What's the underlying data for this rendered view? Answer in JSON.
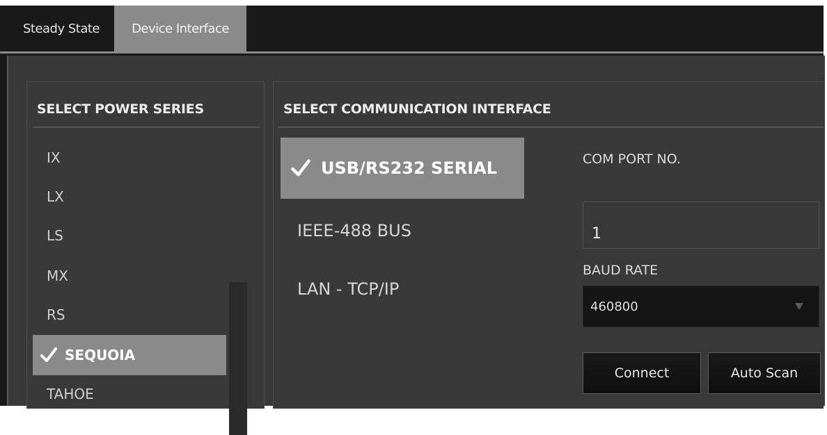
{
  "tabs": [
    {
      "label": "Steady State",
      "active": false
    },
    {
      "label": "Device Interface",
      "active": true
    }
  ],
  "power_series": {
    "title": "SELECT POWER SERIES",
    "items": [
      "IX",
      "LX",
      "LS",
      "MX",
      "RS",
      "SEQUOIA",
      "TAHOE"
    ],
    "selected": "SEQUOIA"
  },
  "communication": {
    "title": "SELECT COMMUNICATION INTERFACE",
    "interfaces": [
      "USB/RS232 SERIAL",
      "IEEE-488 BUS",
      "LAN - TCP/IP"
    ],
    "selected": "USB/RS232 SERIAL",
    "com_port": {
      "label": "COM PORT NO.",
      "value": "1"
    },
    "baud_rate": {
      "label": "BAUD RATE",
      "value": "460800"
    },
    "connect_label": "Connect",
    "auto_scan_label": "Auto Scan"
  },
  "colors": {
    "background": "#383838",
    "selection": "#8a8a8a",
    "text": "#e6e6e6"
  }
}
